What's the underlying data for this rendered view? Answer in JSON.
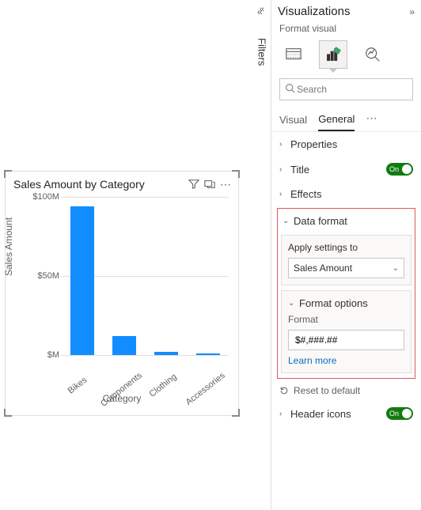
{
  "filters_label": "Filters",
  "chart_data": {
    "type": "bar",
    "title": "Sales Amount by Category",
    "xlabel": "Category",
    "ylabel": "Sales Amount",
    "ylim": [
      0,
      100
    ],
    "ticks": [
      "$M",
      "$50M",
      "$100M"
    ],
    "categories": [
      "Bikes",
      "Components",
      "Clothing",
      "Accessories"
    ],
    "values": [
      94,
      12,
      2,
      1
    ]
  },
  "pane": {
    "title": "Visualizations",
    "subtitle": "Format visual",
    "search_placeholder": "Search",
    "tabs": {
      "visual": "Visual",
      "general": "General"
    },
    "sections": {
      "properties": "Properties",
      "title": "Title",
      "effects": "Effects",
      "data_format": "Data format",
      "header_icons": "Header icons"
    },
    "toggles": {
      "title": "On",
      "header_icons": "On"
    },
    "data_format": {
      "apply_label": "Apply settings to",
      "apply_value": "Sales Amount",
      "format_options_label": "Format options",
      "format_label": "Format",
      "format_value": "$#,###.##",
      "learn_more": "Learn more"
    },
    "reset": "Reset to default"
  }
}
